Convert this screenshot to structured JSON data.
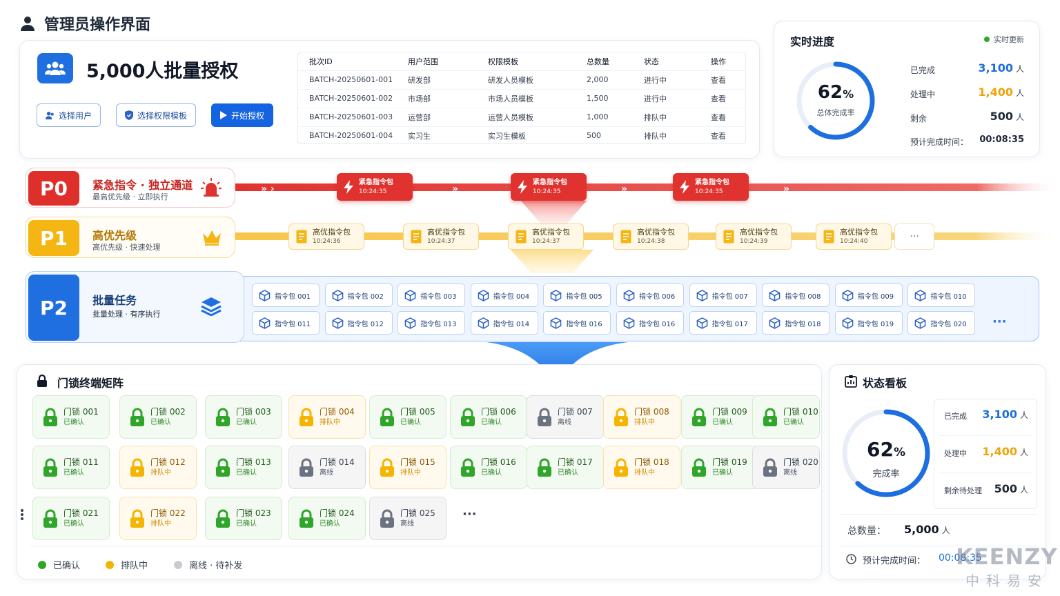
{
  "page": {
    "title": "管理员操作界面"
  },
  "batch": {
    "title": "5,000人批量授权",
    "buttons": {
      "select_users": "选择用户",
      "select_template": "选择权限模板",
      "start": "开始授权"
    },
    "table": {
      "headers": [
        "批次ID",
        "用户范围",
        "权限模板",
        "总数量",
        "状态",
        "操作"
      ],
      "rows": [
        [
          "BATCH-20250601-001",
          "研发部",
          "研发人员模板",
          "2,000",
          "进行中",
          "查看"
        ],
        [
          "BATCH-20250601-002",
          "市场部",
          "市场人员模板",
          "1,500",
          "进行中",
          "查看"
        ],
        [
          "BATCH-20250601-003",
          "运营部",
          "运营人员模板",
          "1,000",
          "排队中",
          "查看"
        ],
        [
          "BATCH-20250601-004",
          "实习生",
          "实习生模板",
          "500",
          "排队中",
          "查看"
        ]
      ]
    }
  },
  "progress": {
    "title": "实时进度",
    "live": "实时更新",
    "percent": "62",
    "percent_value": 0.62,
    "percent_sign": "%",
    "caption": "总体完成率",
    "rows": [
      {
        "label": "已完成",
        "value": "3,100",
        "unit": "人",
        "color": "#1d6fe0"
      },
      {
        "label": "处理中",
        "value": "1,400",
        "unit": "人",
        "color": "#f0a30a"
      },
      {
        "label": "剩余",
        "value": "500",
        "unit": "人",
        "color": "#1f2937"
      },
      {
        "label": "预计完成时间：",
        "value": "00:08:35",
        "unit": "",
        "color": "#1f2937"
      }
    ]
  },
  "lanes": {
    "p0": {
      "badge": "P0",
      "title": "紧急指令 · 独立通道",
      "subtitle": "最高优先级 · 立即执行",
      "packets": [
        {
          "label": "紧急指令包",
          "time": "10:24:35"
        },
        {
          "label": "紧急指令包",
          "time": "10:24:35"
        },
        {
          "label": "紧急指令包",
          "time": "10:24:35"
        }
      ]
    },
    "p1": {
      "badge": "P1",
      "title": "高优先级",
      "subtitle": "高优先级 · 快速处理",
      "more": "···",
      "packets": [
        {
          "label": "高优指令包",
          "time": "10:24:36"
        },
        {
          "label": "高优指令包",
          "time": "10:24:37"
        },
        {
          "label": "高优指令包",
          "time": "10:24:37"
        },
        {
          "label": "高优指令包",
          "time": "10:24:38"
        },
        {
          "label": "高优指令包",
          "time": "10:24:39"
        },
        {
          "label": "高优指令包",
          "time": "10:24:40"
        }
      ]
    },
    "p2": {
      "badge": "P2",
      "title": "批量任务",
      "subtitle": "批量处理 · 有序执行",
      "more": "···",
      "packets": [
        "指令包 001",
        "指令包 002",
        "指令包 003",
        "指令包 004",
        "指令包 005",
        "指令包 006",
        "指令包 007",
        "指令包 008",
        "指令包 009",
        "指令包 010",
        "指令包 011",
        "指令包 012",
        "指令包 013",
        "指令包 014",
        "指令包 016",
        "指令包 016",
        "指令包 017",
        "指令包 018",
        "指令包 019",
        "指令包 020"
      ]
    }
  },
  "matrix": {
    "title": "门锁终端矩阵",
    "more": "···",
    "locks": [
      {
        "name": "门锁 001",
        "status": "已确认",
        "state": "g"
      },
      {
        "name": "门锁 002",
        "status": "已确认",
        "state": "g"
      },
      {
        "name": "门锁 003",
        "status": "已确认",
        "state": "g"
      },
      {
        "name": "门锁 004",
        "status": "排队中",
        "state": "y"
      },
      {
        "name": "门锁 005",
        "status": "已确认",
        "state": "g"
      },
      {
        "name": "门锁 006",
        "status": "已确认",
        "state": "g"
      },
      {
        "name": "门锁 007",
        "status": "离线",
        "state": "n"
      },
      {
        "name": "门锁 008",
        "status": "排队中",
        "state": "y"
      },
      {
        "name": "门锁 009",
        "status": "已确认",
        "state": "g"
      },
      {
        "name": "门锁 010",
        "status": "已确认",
        "state": "g"
      },
      {
        "name": "门锁 011",
        "status": "已确认",
        "state": "g"
      },
      {
        "name": "门锁 012",
        "status": "排队中",
        "state": "y"
      },
      {
        "name": "门锁 013",
        "status": "已确认",
        "state": "g"
      },
      {
        "name": "门锁 014",
        "status": "离线",
        "state": "n"
      },
      {
        "name": "门锁 015",
        "status": "排队中",
        "state": "y"
      },
      {
        "name": "门锁 016",
        "status": "已确认",
        "state": "g"
      },
      {
        "name": "门锁 017",
        "status": "已确认",
        "state": "g"
      },
      {
        "name": "门锁 018",
        "status": "排队中",
        "state": "y"
      },
      {
        "name": "门锁 019",
        "status": "已确认",
        "state": "g"
      },
      {
        "name": "门锁 020",
        "status": "离线",
        "state": "n"
      },
      {
        "name": "门锁 021",
        "status": "已确认",
        "state": "g"
      },
      {
        "name": "门锁 022",
        "status": "排队中",
        "state": "y"
      },
      {
        "name": "门锁 023",
        "status": "已确认",
        "state": "g"
      },
      {
        "name": "门锁 024",
        "status": "已确认",
        "state": "g"
      },
      {
        "name": "门锁 025",
        "status": "离线",
        "state": "n"
      }
    ],
    "legend": [
      {
        "label": "已确认",
        "color": "#2fa52a"
      },
      {
        "label": "排队中",
        "color": "#f4b400"
      },
      {
        "label": "离线 · 待补发",
        "color": "#c9cbd0"
      }
    ]
  },
  "board": {
    "title": "状态看板",
    "percent": "62",
    "percent_value": 0.62,
    "percent_sign": "%",
    "caption": "完成率",
    "stats": [
      {
        "label": "已完成",
        "value": "3,100",
        "unit": "人",
        "color": "#1d6fe0"
      },
      {
        "label": "处理中",
        "value": "1,400",
        "unit": "人",
        "color": "#f0a30a"
      },
      {
        "label": "剩余待处理",
        "value": "500",
        "unit": "人",
        "color": "#1f2937"
      }
    ],
    "total_label": "总数量：",
    "total_value": "5,000",
    "total_unit": "人",
    "eta_label": "预计完成时间：",
    "eta_value": "00:08:35"
  },
  "watermark": {
    "brand": "KEENZY",
    "cn": "中科易安"
  },
  "colors": {
    "primary": "#1d6fe0",
    "p0": "#e0322e",
    "p1": "#f4b400",
    "p2": "#1f6fe0",
    "confirmed": "#2fa52a",
    "queued": "#f4b400",
    "offline": "#9ca3af"
  }
}
